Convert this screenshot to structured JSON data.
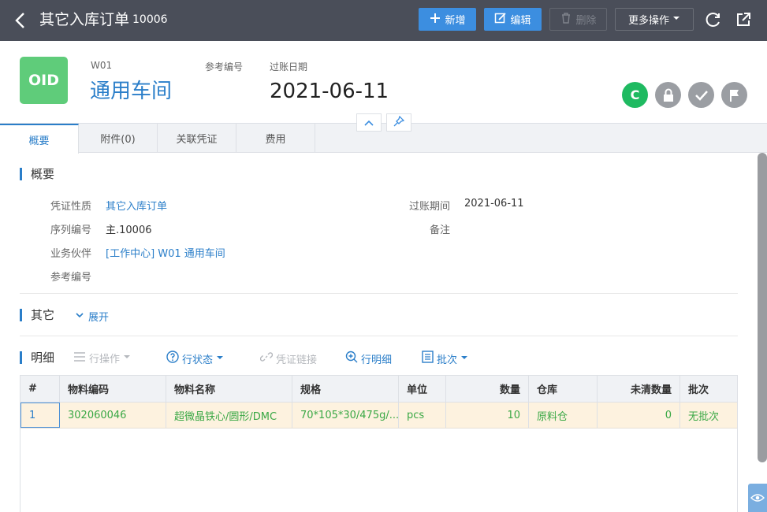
{
  "topbar": {
    "title": "其它入库订单",
    "doc_no": "10006",
    "btn_new": "新增",
    "btn_edit": "编辑",
    "btn_delete": "删除",
    "btn_more": "更多操作"
  },
  "header": {
    "logo_text": "OID",
    "code_label": "W01",
    "name_value": "通用车间",
    "ref_label": "参考编号",
    "date_label": "过账日期",
    "date_value": "2021-06-11",
    "status_letter": "C",
    "colors": {
      "status": "#1fba61",
      "muted": "#9b9ea3",
      "logo": "#5fcc7a"
    }
  },
  "tabs": [
    {
      "label": "概要",
      "active": true
    },
    {
      "label": "附件(0)"
    },
    {
      "label": "关联凭证"
    },
    {
      "label": "费用"
    }
  ],
  "summary": {
    "title": "概要",
    "fields_left": [
      {
        "label": "凭证性质",
        "value": "其它入库订单"
      },
      {
        "label": "序列编号",
        "value": "主.10006"
      },
      {
        "label": "业务伙伴",
        "value": "[工作中心] W01 通用车间"
      },
      {
        "label": "参考编号",
        "value": ""
      }
    ],
    "fields_right": [
      {
        "label": "过账期间",
        "value": "2021-06-11"
      },
      {
        "label": "备注",
        "value": ""
      }
    ]
  },
  "other": {
    "title": "其它",
    "expand_label": "展开"
  },
  "detail": {
    "title": "明细",
    "actions": {
      "row_ops": "行操作",
      "row_status": "行状态",
      "doc_link": "凭证链接",
      "row_detail": "行明细",
      "batch": "批次"
    },
    "columns": [
      "#",
      "物料编码",
      "物料名称",
      "规格",
      "单位",
      "数量",
      "仓库",
      "未清数量",
      "批次"
    ],
    "rows": [
      [
        "1",
        "302060046",
        "超微晶铁心/圆形/DMC",
        "70*105*30/475g/...",
        "pcs",
        "10",
        "原料仓",
        "0",
        "无批次"
      ]
    ]
  }
}
